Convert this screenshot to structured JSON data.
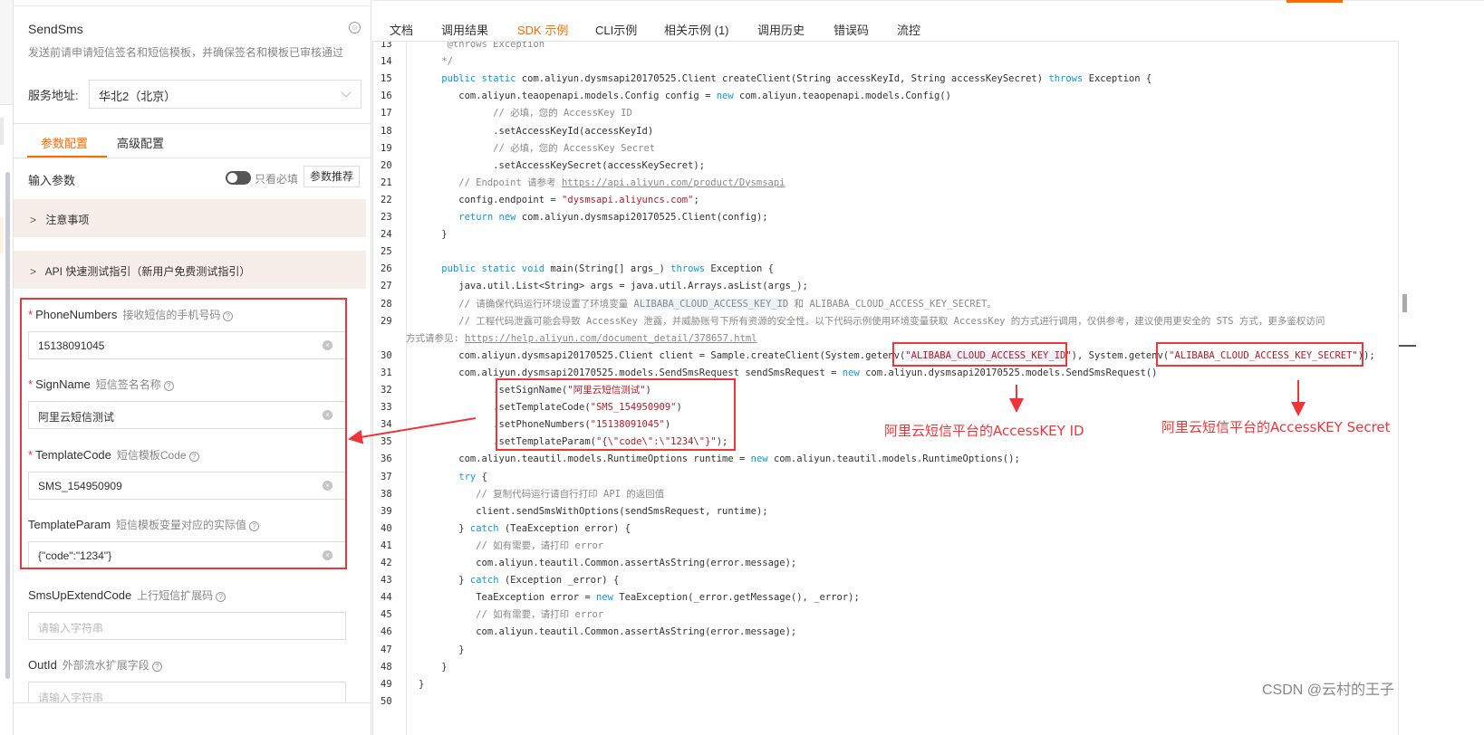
{
  "panel": {
    "api_name": "SendSms",
    "api_desc": "发送前请申请短信签名和短信模板，并确保签名和模板已审核通过",
    "service_address_label": "服务地址:",
    "service_address_value": "华北2（北京）",
    "tabs": [
      {
        "label": "参数配置",
        "active": true
      },
      {
        "label": "高级配置",
        "active": false
      }
    ],
    "input_params_label": "输入参数",
    "required_only_label": "只看必填",
    "required_only_on": false,
    "recommend_button": "参数推荐",
    "collapsibles": [
      {
        "label": "注意事项"
      },
      {
        "label": "API 快速测试指引（新用户免费测试指引）"
      }
    ],
    "fields": [
      {
        "name": "PhoneNumbers",
        "hint": "接收短信的手机号码",
        "required": true,
        "value": "15138091045",
        "placeholder": ""
      },
      {
        "name": "SignName",
        "hint": "短信签名名称",
        "required": true,
        "value": "阿里云短信测试",
        "placeholder": ""
      },
      {
        "name": "TemplateCode",
        "hint": "短信模板Code",
        "required": true,
        "value": "SMS_154950909",
        "placeholder": ""
      },
      {
        "name": "TemplateParam",
        "hint": "短信模板变量对应的实际值",
        "required": false,
        "value": "{\"code\":\"1234\"}",
        "placeholder": ""
      },
      {
        "name": "SmsUpExtendCode",
        "hint": "上行短信扩展码",
        "required": false,
        "value": "",
        "placeholder": "请输入字符串"
      },
      {
        "name": "OutId",
        "hint": "外部流水扩展字段",
        "required": false,
        "value": "",
        "placeholder": "请输入字符串"
      }
    ]
  },
  "main_tabs": [
    {
      "label": "文档",
      "active": false
    },
    {
      "label": "调用结果",
      "active": false
    },
    {
      "label": "SDK 示例",
      "active": true
    },
    {
      "label": "CLI示例",
      "active": false
    },
    {
      "label": "相关示例 (1)",
      "active": false
    },
    {
      "label": "调用历史",
      "active": false
    },
    {
      "label": "错误码",
      "active": false
    },
    {
      "label": "流控",
      "active": false
    }
  ],
  "code_lines": [
    {
      "n": "13",
      "t": "     @throws Exception",
      "cls": "cm"
    },
    {
      "n": "14",
      "t": "    */",
      "cls": "cm"
    },
    {
      "n": "15",
      "t": "",
      "rich": "line15"
    },
    {
      "n": "16",
      "t": "",
      "rich": "line16"
    },
    {
      "n": "17",
      "t": "             // 必填，您的 AccessKey ID",
      "cls": "cm"
    },
    {
      "n": "18",
      "t": "             .setAccessKeyId(accessKeyId)",
      "cls": ""
    },
    {
      "n": "19",
      "t": "             // 必填，您的 AccessKey Secret",
      "cls": "cm"
    },
    {
      "n": "20",
      "t": "             .setAccessKeySecret(accessKeySecret);",
      "cls": ""
    },
    {
      "n": "21",
      "t": "",
      "rich": "line21"
    },
    {
      "n": "22",
      "t": "",
      "rich": "line22"
    },
    {
      "n": "23",
      "t": "",
      "rich": "line23"
    },
    {
      "n": "24",
      "t": "    }",
      "cls": ""
    },
    {
      "n": "25",
      "t": "",
      "cls": ""
    },
    {
      "n": "26",
      "t": "",
      "rich": "line26"
    },
    {
      "n": "27",
      "t": "       java.util.List<String> args = java.util.Arrays.asList(args_);",
      "cls": ""
    },
    {
      "n": "28",
      "t": "",
      "rich": "line28"
    },
    {
      "n": "29",
      "t": "       // 工程代码泄露可能会导致 AccessKey 泄露，并威胁账号下所有资源的安全性。以下代码示例使用环境变量获取 AccessKey 的方式进行调用，仅供参考，建议使用更安全的 STS 方式，更多鉴权访问",
      "cls": "cm"
    },
    {
      "n": "",
      "t": "",
      "rich": "line29b"
    },
    {
      "n": "30",
      "t": "",
      "rich": "line30"
    },
    {
      "n": "31",
      "t": "",
      "rich": "line31"
    },
    {
      "n": "32",
      "t": "",
      "rich": "line32"
    },
    {
      "n": "33",
      "t": "",
      "rich": "line33"
    },
    {
      "n": "34",
      "t": "",
      "rich": "line34"
    },
    {
      "n": "35",
      "t": "",
      "rich": "line35"
    },
    {
      "n": "36",
      "t": "",
      "rich": "line36"
    },
    {
      "n": "37",
      "t": "",
      "rich": "line37"
    },
    {
      "n": "38",
      "t": "          // 复制代码运行请自行打印 API 的返回值",
      "cls": "cm"
    },
    {
      "n": "39",
      "t": "          client.sendSmsWithOptions(sendSmsRequest, runtime);",
      "cls": ""
    },
    {
      "n": "40",
      "t": "",
      "rich": "line40"
    },
    {
      "n": "41",
      "t": "          // 如有需要，请打印 error",
      "cls": "cm"
    },
    {
      "n": "42",
      "t": "          com.aliyun.teautil.Common.assertAsString(error.message);",
      "cls": ""
    },
    {
      "n": "43",
      "t": "",
      "rich": "line43"
    },
    {
      "n": "44",
      "t": "",
      "rich": "line44"
    },
    {
      "n": "45",
      "t": "          // 如有需要，请打印 error",
      "cls": "cm"
    },
    {
      "n": "46",
      "t": "          com.aliyun.teautil.Common.assertAsString(error.message);",
      "cls": ""
    },
    {
      "n": "47",
      "t": "       }",
      "cls": ""
    },
    {
      "n": "48",
      "t": "    }",
      "cls": ""
    },
    {
      "n": "49",
      "t": "}",
      "cls": ""
    },
    {
      "n": "50",
      "t": "",
      "cls": ""
    }
  ],
  "rich_lines": {
    "line15": [
      [
        "    ",
        ""
      ],
      [
        "public static",
        "kw"
      ],
      [
        " com.aliyun.dysmsapi20170525.Client createClient(String accessKeyId, String accessKeySecret) ",
        ""
      ],
      [
        "throws",
        "kw"
      ],
      [
        " Exception {",
        ""
      ]
    ],
    "line16": [
      [
        "       com.aliyun.teaopenapi.models.Config config = ",
        ""
      ],
      [
        "new",
        "kw"
      ],
      [
        " com.aliyun.teaopenapi.models.Config()",
        ""
      ]
    ],
    "line21": [
      [
        "       // Endpoint 请参考 ",
        "cm"
      ],
      [
        "https://api.aliyun.com/product/Dysmsapi",
        "cm-link"
      ]
    ],
    "line22": [
      [
        "       config.endpoint = ",
        ""
      ],
      [
        "\"dysmsapi.aliyuncs.com\"",
        "str"
      ],
      [
        ";",
        ""
      ]
    ],
    "line23": [
      [
        "       ",
        ""
      ],
      [
        "return new",
        "kw"
      ],
      [
        " com.aliyun.dysmsapi20170525.Client(config);",
        ""
      ]
    ],
    "line26": [
      [
        "    ",
        ""
      ],
      [
        "public static void",
        "kw"
      ],
      [
        " main(String[] args_) ",
        ""
      ],
      [
        "throws",
        "kw"
      ],
      [
        " Exception {",
        ""
      ]
    ],
    "line28": [
      [
        "       // 请确保代码运行环境设置了环境变量 ",
        "cm"
      ],
      [
        "ALIBABA_CLOUD_ACCESS_KEY_ID",
        "cm-hl"
      ],
      [
        " 和 ALIBABA_CLOUD_ACCESS_KEY_SECRET。",
        "cm"
      ]
    ],
    "line29b": [
      [
        "方式请参见: ",
        "cm"
      ],
      [
        "https://help.aliyun.com/document_detail/378657.html",
        "cm-link"
      ]
    ],
    "line30": [
      [
        "       com.aliyun.dysmsapi20170525.Client client = Sample.createClient(System.getenv(",
        ""
      ],
      [
        "\"ALIBABA_CLOUD_ACCESS_KEY_ID\"",
        "str-hl"
      ],
      [
        "), System.getenv(",
        ""
      ],
      [
        "\"ALIBABA_CLOUD_ACCESS_KEY_SECRET\"",
        "str"
      ],
      [
        "));",
        ""
      ]
    ],
    "line31": [
      [
        "       com.aliyun.dysmsapi20170525.models.SendSmsRequest sendSmsRequest = ",
        ""
      ],
      [
        "new",
        "kw"
      ],
      [
        " com.aliyun.dysmsapi20170525.models.SendSmsRequest()",
        ""
      ]
    ],
    "line32": [
      [
        "             .setSignName(",
        ""
      ],
      [
        "\"阿里云短信测试\"",
        "str"
      ],
      [
        ")",
        ""
      ]
    ],
    "line33": [
      [
        "             .setTemplateCode(",
        ""
      ],
      [
        "\"SMS_154950909\"",
        "str"
      ],
      [
        ")",
        ""
      ]
    ],
    "line34": [
      [
        "             .setPhoneNumbers(",
        ""
      ],
      [
        "\"15138091045\"",
        "str"
      ],
      [
        ")",
        ""
      ]
    ],
    "line35": [
      [
        "             .setTemplateParam(",
        ""
      ],
      [
        "\"{\\\"code\\\":\\\"1234\\\"}\"",
        "str"
      ],
      [
        ");",
        ""
      ]
    ],
    "line36": [
      [
        "       com.aliyun.teautil.models.RuntimeOptions runtime = ",
        ""
      ],
      [
        "new",
        "kw"
      ],
      [
        " com.aliyun.teautil.models.RuntimeOptions();",
        ""
      ]
    ],
    "line37": [
      [
        "       ",
        ""
      ],
      [
        "try",
        "kw"
      ],
      [
        " {",
        ""
      ]
    ],
    "line40": [
      [
        "       } ",
        ""
      ],
      [
        "catch",
        "kw"
      ],
      [
        " (TeaException error) {",
        ""
      ]
    ],
    "line43": [
      [
        "       } ",
        ""
      ],
      [
        "catch",
        "kw"
      ],
      [
        " (Exception _error) {",
        ""
      ]
    ],
    "line44": [
      [
        "          TeaException error = ",
        ""
      ],
      [
        "new",
        "kw"
      ],
      [
        " TeaException(_error.getMessage(), _error);",
        ""
      ]
    ]
  },
  "annotations": {
    "key_id_note": "阿里云短信平台的AccessKEY ID",
    "key_secret_note": "阿里云短信平台的AccessKEY Secret"
  },
  "watermark": "CSDN @云村的王子",
  "colors": {
    "accent": "#ff6a00",
    "annotation_red": "#f0353a",
    "keyword": "#0a9ae0",
    "string": "#b31d28",
    "comment": "#8a8a8a"
  }
}
